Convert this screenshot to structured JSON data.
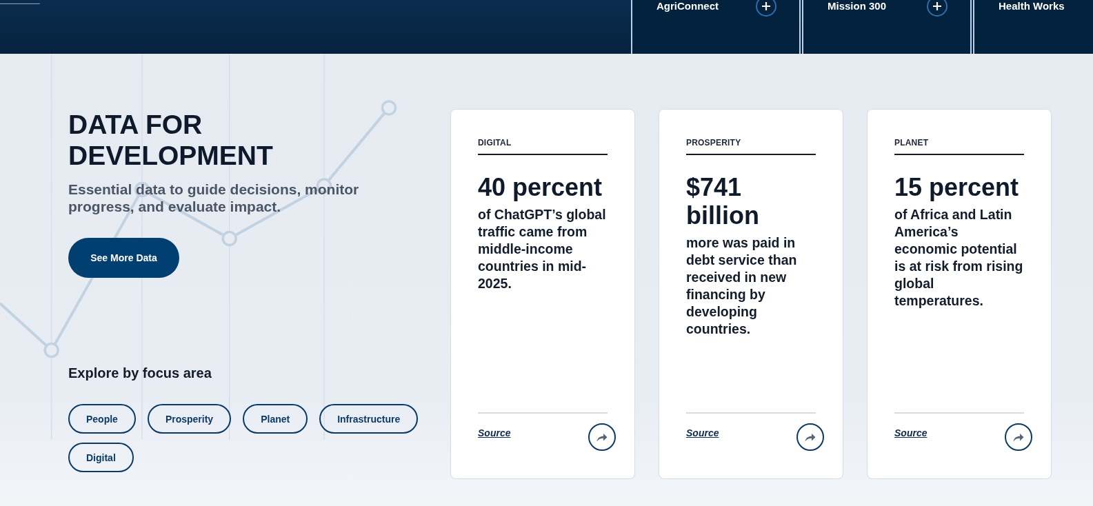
{
  "header": {
    "tiles": [
      {
        "label": "AgriConnect",
        "kind": "expandable"
      },
      {
        "label": "Mission 300",
        "kind": "expandable"
      },
      {
        "label": "Health Works",
        "kind": "plain"
      }
    ]
  },
  "hero": {
    "title": "DATA FOR DEVELOPMENT",
    "subtitle": "Essential data to guide decisions, monitor progress, and evaluate impact.",
    "button": "See More Data"
  },
  "focus_areas": {
    "heading": "Explore by focus area",
    "tags": [
      "People",
      "Prosperity",
      "Planet",
      "Infrastructure",
      "Digital"
    ]
  },
  "cards": [
    {
      "category": "DIGITAL",
      "stat": "40 percent",
      "description": "of ChatGPT’s global traffic came from middle-income countries in mid-2025.",
      "source": "Source"
    },
    {
      "category": "PROSPERITY",
      "stat": "$741 billion",
      "description": "more was paid in debt service than received in new financing by developing countries.",
      "source": "Source"
    },
    {
      "category": "PLANET",
      "stat": "15 percent",
      "description": "of Africa and Latin America’s economic potential is at risk from rising global temperatures.",
      "source": "Source"
    }
  ]
}
